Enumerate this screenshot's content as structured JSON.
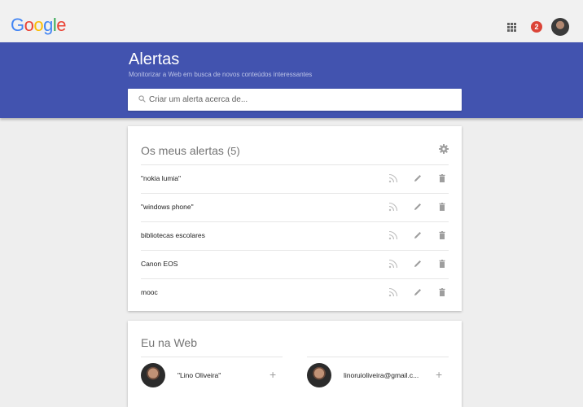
{
  "header": {
    "logo": [
      "G",
      "o",
      "o",
      "g",
      "l",
      "e"
    ],
    "logo_colors": [
      "#4285f4",
      "#ea4335",
      "#fbbc05",
      "#4285f4",
      "#34a853",
      "#ea4335"
    ],
    "notifications_count": "2"
  },
  "banner": {
    "title": "Alertas",
    "subtitle": "Monitorizar a Web em busca de novos conteúdos interessantes",
    "search_placeholder": "Criar um alerta acerca de..."
  },
  "alerts": {
    "title": "Os meus alertas",
    "count": "(5)",
    "items": [
      {
        "label": "\"nokia lumia\""
      },
      {
        "label": "\"windows phone\""
      },
      {
        "label": "bibliotecas escolares"
      },
      {
        "label": "Canon EOS"
      },
      {
        "label": "mooc"
      }
    ]
  },
  "me_on_web": {
    "title": "Eu na Web",
    "people": [
      {
        "name": "\"Lino Oliveira\"",
        "action": "+"
      },
      {
        "name": "linoruioliveira@gmail.c...",
        "action": "+"
      }
    ]
  },
  "colors": {
    "banner": "#4253af",
    "notification": "#db4437",
    "icon_gray": "#9e9e9e"
  }
}
